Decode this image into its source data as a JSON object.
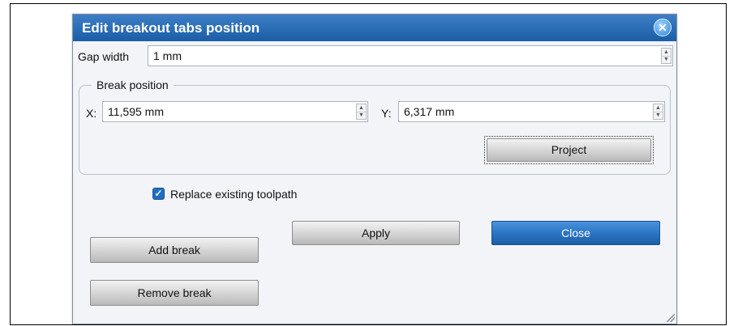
{
  "dialog": {
    "title": "Edit breakout tabs position",
    "close_icon": "close-icon"
  },
  "gap": {
    "label": "Gap width",
    "value": "1 mm"
  },
  "break_position": {
    "group_label": "Break position",
    "x_label": "X:",
    "x_value": "11,595 mm",
    "y_label": "Y:",
    "y_value": "6,317 mm",
    "project_label": "Project"
  },
  "options": {
    "replace_label": "Replace existing toolpath",
    "replace_checked": true
  },
  "buttons": {
    "apply": "Apply",
    "close": "Close",
    "add_break": "Add break",
    "remove_break": "Remove break"
  },
  "colors": {
    "titlebar": "#1c5ea6",
    "primary_button": "#2e78c8",
    "background": "#f2f4f7"
  }
}
